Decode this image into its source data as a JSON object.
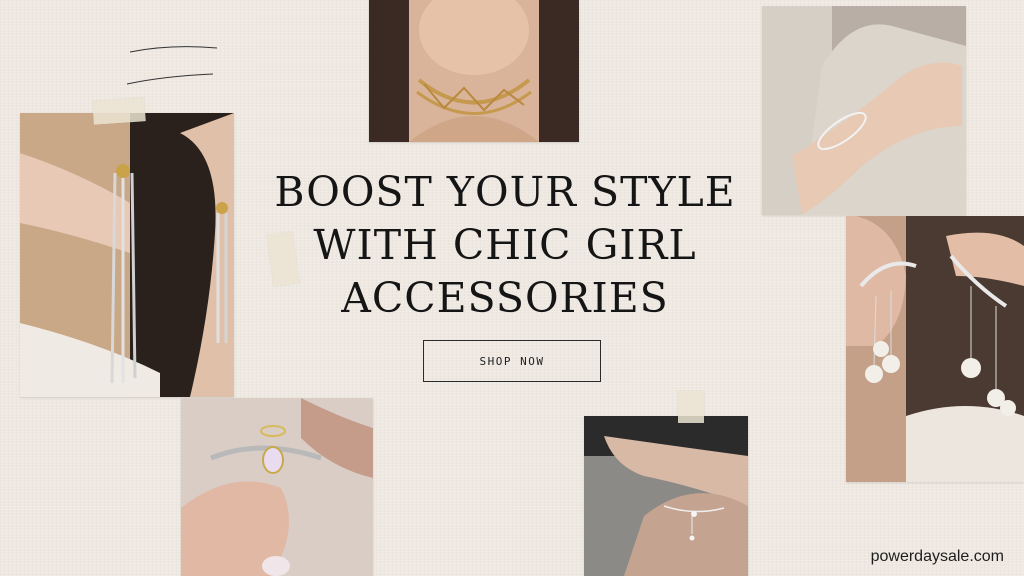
{
  "headline": {
    "line1": "BOOST YOUR STYLE",
    "line2": "WITH CHIC GIRL",
    "line3": "ACCESSORIES"
  },
  "cta": {
    "label": "SHOP NOW"
  },
  "watermark": {
    "text": "powerdaysale.com"
  },
  "photos": [
    {
      "name": "choker-necklace-photo",
      "subject": "gold lattice choker necklace"
    },
    {
      "name": "tassel-earrings-photo",
      "subject": "silver tassel drop earrings"
    },
    {
      "name": "bracelet-photo",
      "subject": "delicate silver bracelet on wrist"
    },
    {
      "name": "pearl-ear-cuff-photo",
      "subject": "pearl ear cuff earrings"
    },
    {
      "name": "angel-ring-photo",
      "subject": "opal angel wing ring"
    },
    {
      "name": "anklet-photo",
      "subject": "silver anklet chain"
    }
  ],
  "colors": {
    "background": "#eee8e1",
    "text": "#151515"
  }
}
